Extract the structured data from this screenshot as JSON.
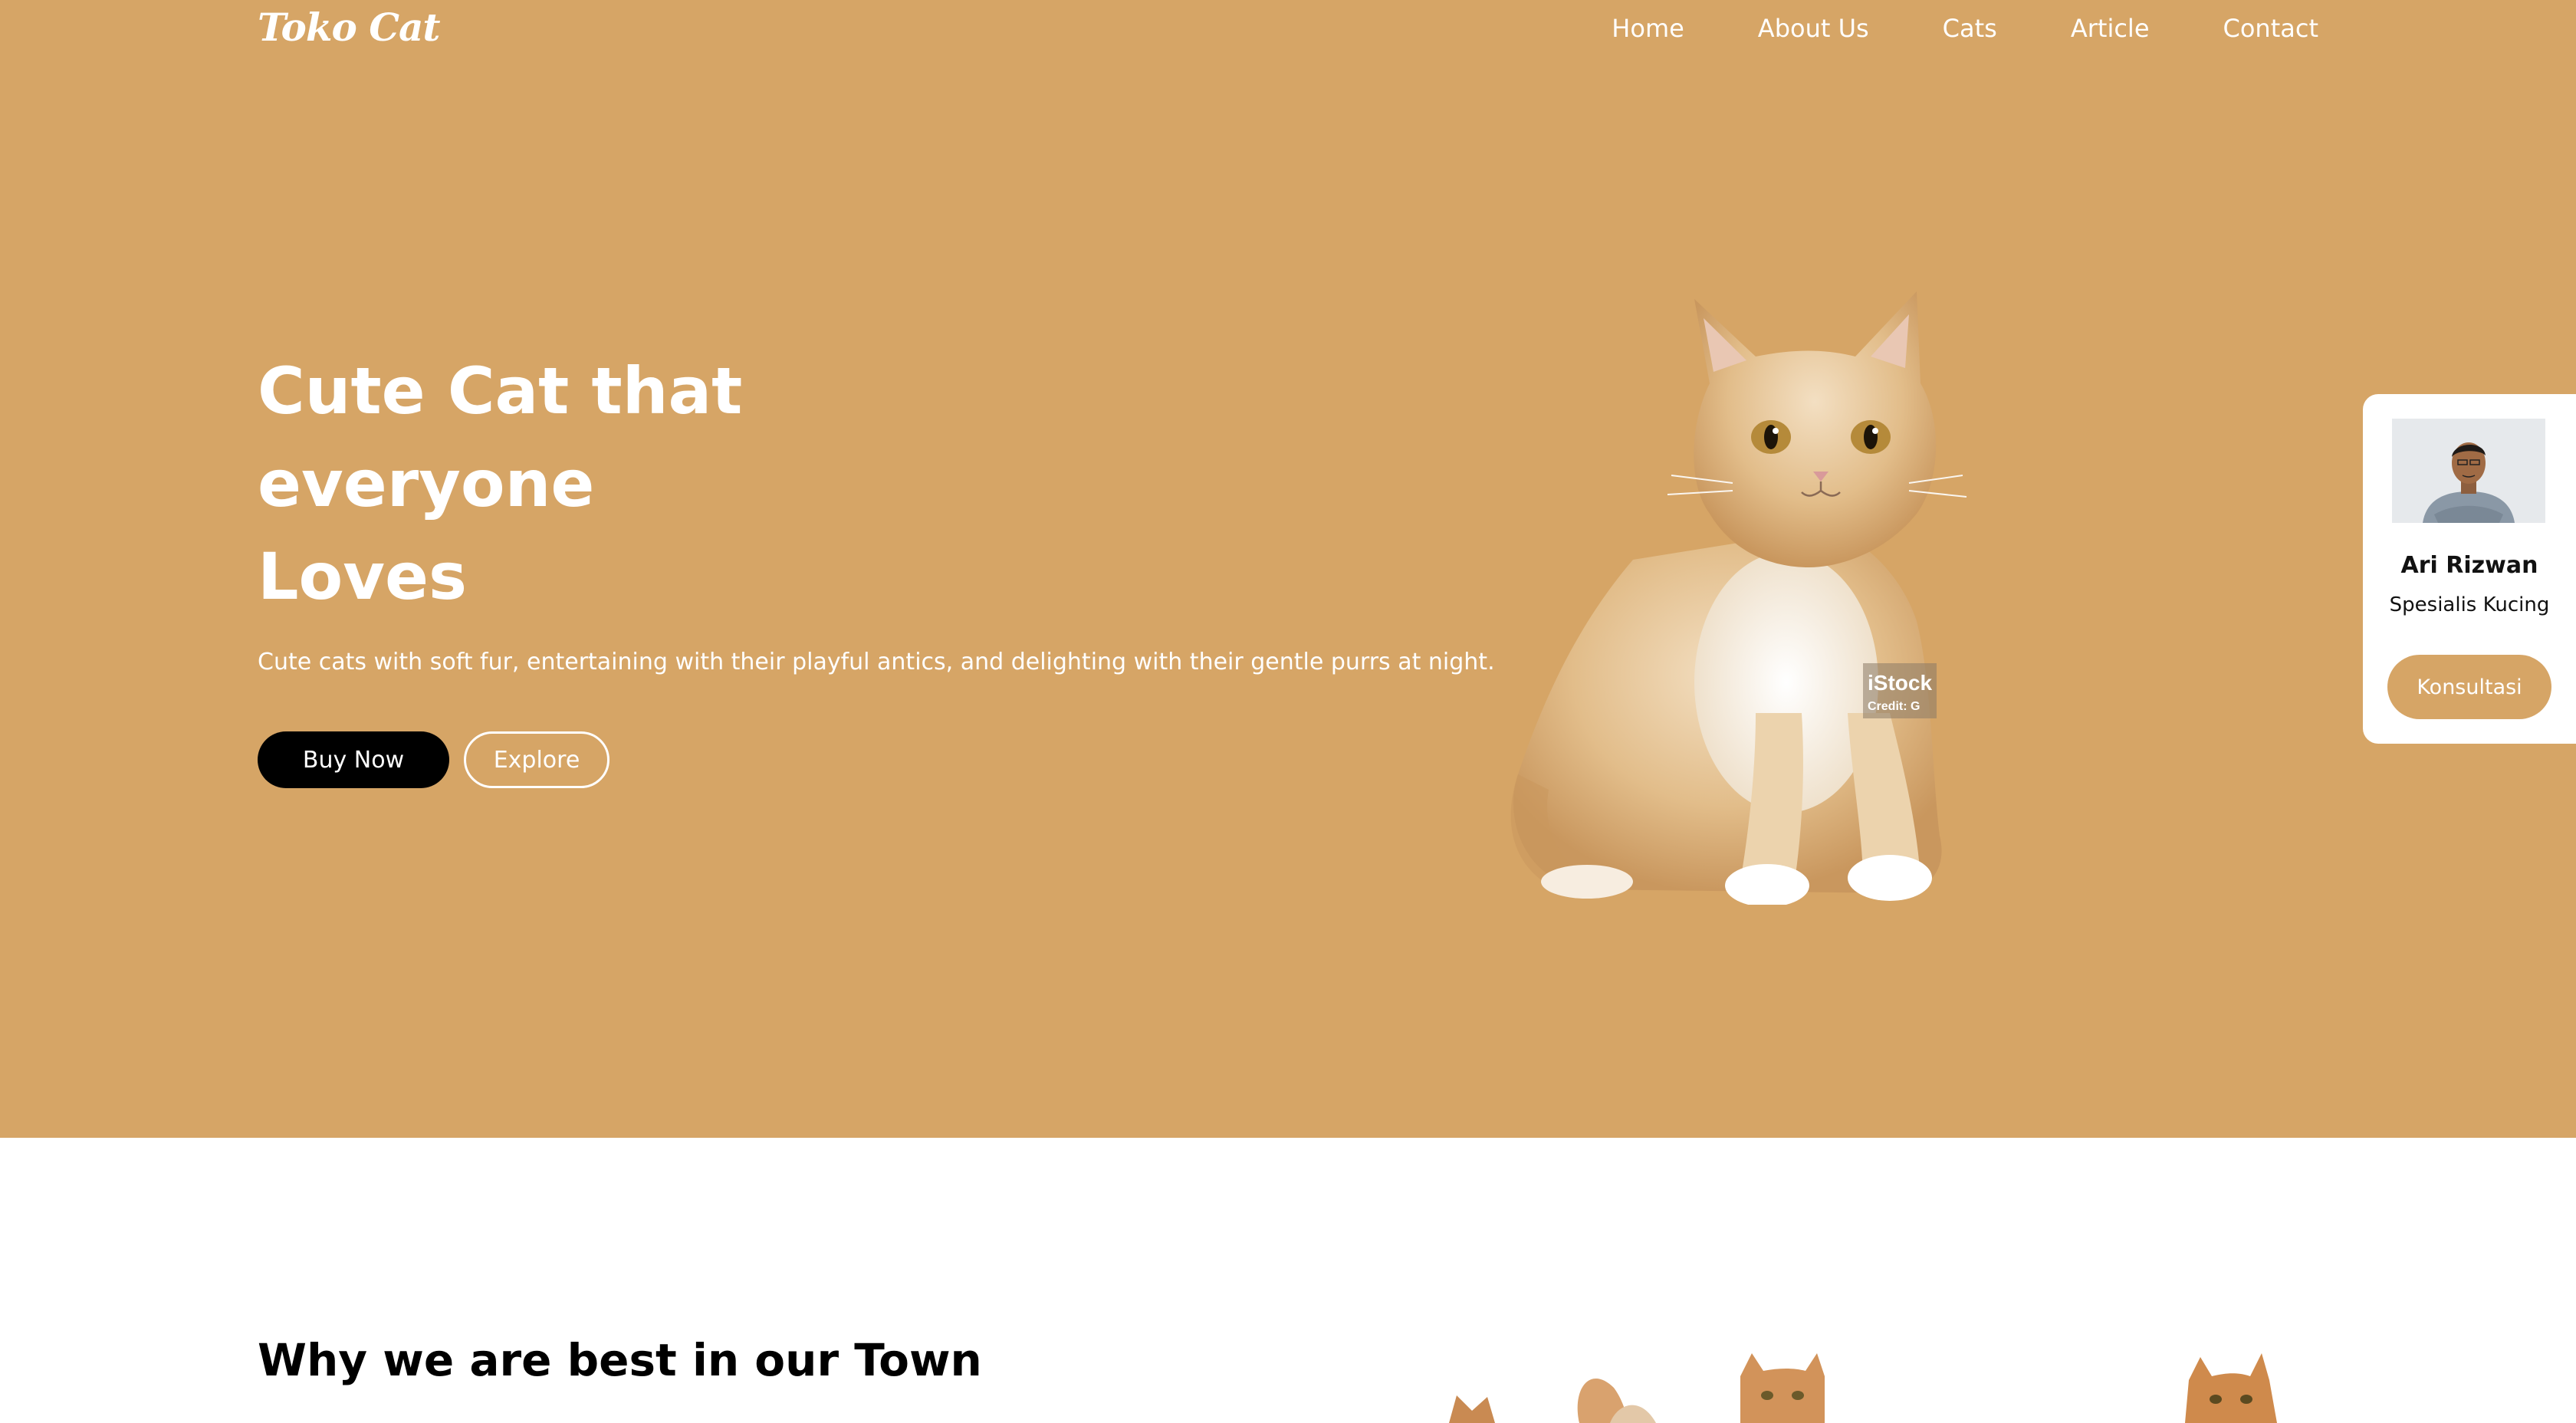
{
  "brand": {
    "logo": "Toko Cat",
    "accent_color": "#d6a566"
  },
  "nav": {
    "items": [
      "Home",
      "About Us",
      "Cats",
      "Article",
      "Contact"
    ]
  },
  "hero": {
    "headline": [
      "Cute Cat that",
      "everyone",
      "Loves"
    ],
    "subtitle": "Cute cats with soft fur, entertaining with their playful antics, and delighting with their gentle purrs at night.",
    "primary_button": "Buy Now",
    "secondary_button": "Explore",
    "image_watermark": "iStock",
    "image_credit": "Credit: G"
  },
  "consultant_card": {
    "name": "Ari Rizwan",
    "role": "Spesialis Kucing",
    "button": "Konsultasi"
  },
  "section": {
    "title": "Why we are best in our Town"
  },
  "icons": [
    "cat-photo",
    "avatar-photo"
  ]
}
